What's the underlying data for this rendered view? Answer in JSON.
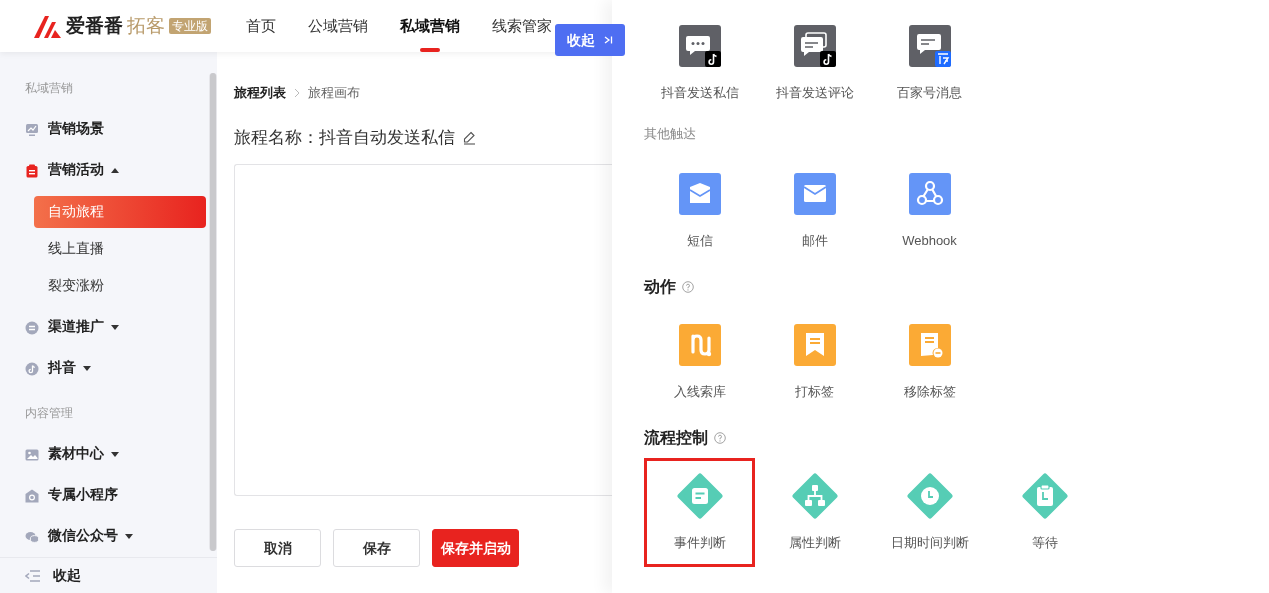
{
  "header": {
    "logo": {
      "brand": "爱番番",
      "product": "拓客",
      "edition": "专业版"
    },
    "nav": [
      {
        "label": "首页",
        "selected": false
      },
      {
        "label": "公域营销",
        "selected": false
      },
      {
        "label": "私域营销",
        "selected": true
      },
      {
        "label": "线索管家",
        "selected": false
      }
    ],
    "collapse_button": "收起"
  },
  "sidebar": {
    "groups": [
      {
        "title": "私域营销",
        "items": [
          {
            "label": "营销场景",
            "kind": "scene"
          },
          {
            "label": "营销活动",
            "kind": "activity",
            "expanded": true,
            "children": [
              {
                "label": "自动旅程",
                "selected": true
              },
              {
                "label": "线上直播",
                "selected": false
              },
              {
                "label": "裂变涨粉",
                "selected": false
              }
            ]
          },
          {
            "label": "渠道推广",
            "kind": "channel",
            "expanded": false
          },
          {
            "label": "抖音",
            "kind": "douyin",
            "expanded": false
          }
        ]
      },
      {
        "title": "内容管理",
        "items": [
          {
            "label": "素材中心",
            "kind": "material",
            "expanded": false
          },
          {
            "label": "专属小程序",
            "kind": "miniapp"
          },
          {
            "label": "微信公众号",
            "kind": "wechat",
            "expanded": false
          }
        ]
      }
    ],
    "collapse": "收起"
  },
  "breadcrumb": [
    "旅程列表",
    "旅程画布"
  ],
  "journey_title": "旅程名称：抖音自动发送私信",
  "buttons": [
    {
      "label": "取消",
      "kind": "default"
    },
    {
      "label": "保存",
      "kind": "default"
    },
    {
      "label": "保存并启动",
      "kind": "primary"
    }
  ],
  "panel": {
    "sections": [
      {
        "kind": "plain",
        "items": [
          {
            "label": "抖音发送私信",
            "kind": "chat",
            "selected": false
          },
          {
            "label": "抖音发送评论",
            "kind": "comments",
            "selected": false
          },
          {
            "label": "百家号消息",
            "kind": "baijia",
            "selected": false
          }
        ]
      },
      {
        "kind": "minor",
        "title": "其他触达",
        "items": [
          {
            "label": "短信",
            "kind": "sms",
            "selected": false
          },
          {
            "label": "邮件",
            "kind": "mail",
            "selected": false
          },
          {
            "label": "Webhook",
            "kind": "webhook",
            "selected": false
          }
        ]
      },
      {
        "kind": "major",
        "title": "动作",
        "help": true,
        "items": [
          {
            "label": "入线索库",
            "kind": "clue",
            "selected": false
          },
          {
            "label": "打标签",
            "kind": "tag",
            "selected": false
          },
          {
            "label": "移除标签",
            "kind": "untag",
            "selected": false
          }
        ]
      },
      {
        "kind": "major",
        "title": "流程控制",
        "help": true,
        "items": [
          {
            "label": "事件判断",
            "kind": "event",
            "selected": true
          },
          {
            "label": "属性判断",
            "kind": "attribute",
            "selected": false
          },
          {
            "label": "日期时间判断",
            "kind": "datetime",
            "selected": false
          },
          {
            "label": "等待",
            "kind": "wait",
            "selected": false
          }
        ]
      }
    ]
  }
}
